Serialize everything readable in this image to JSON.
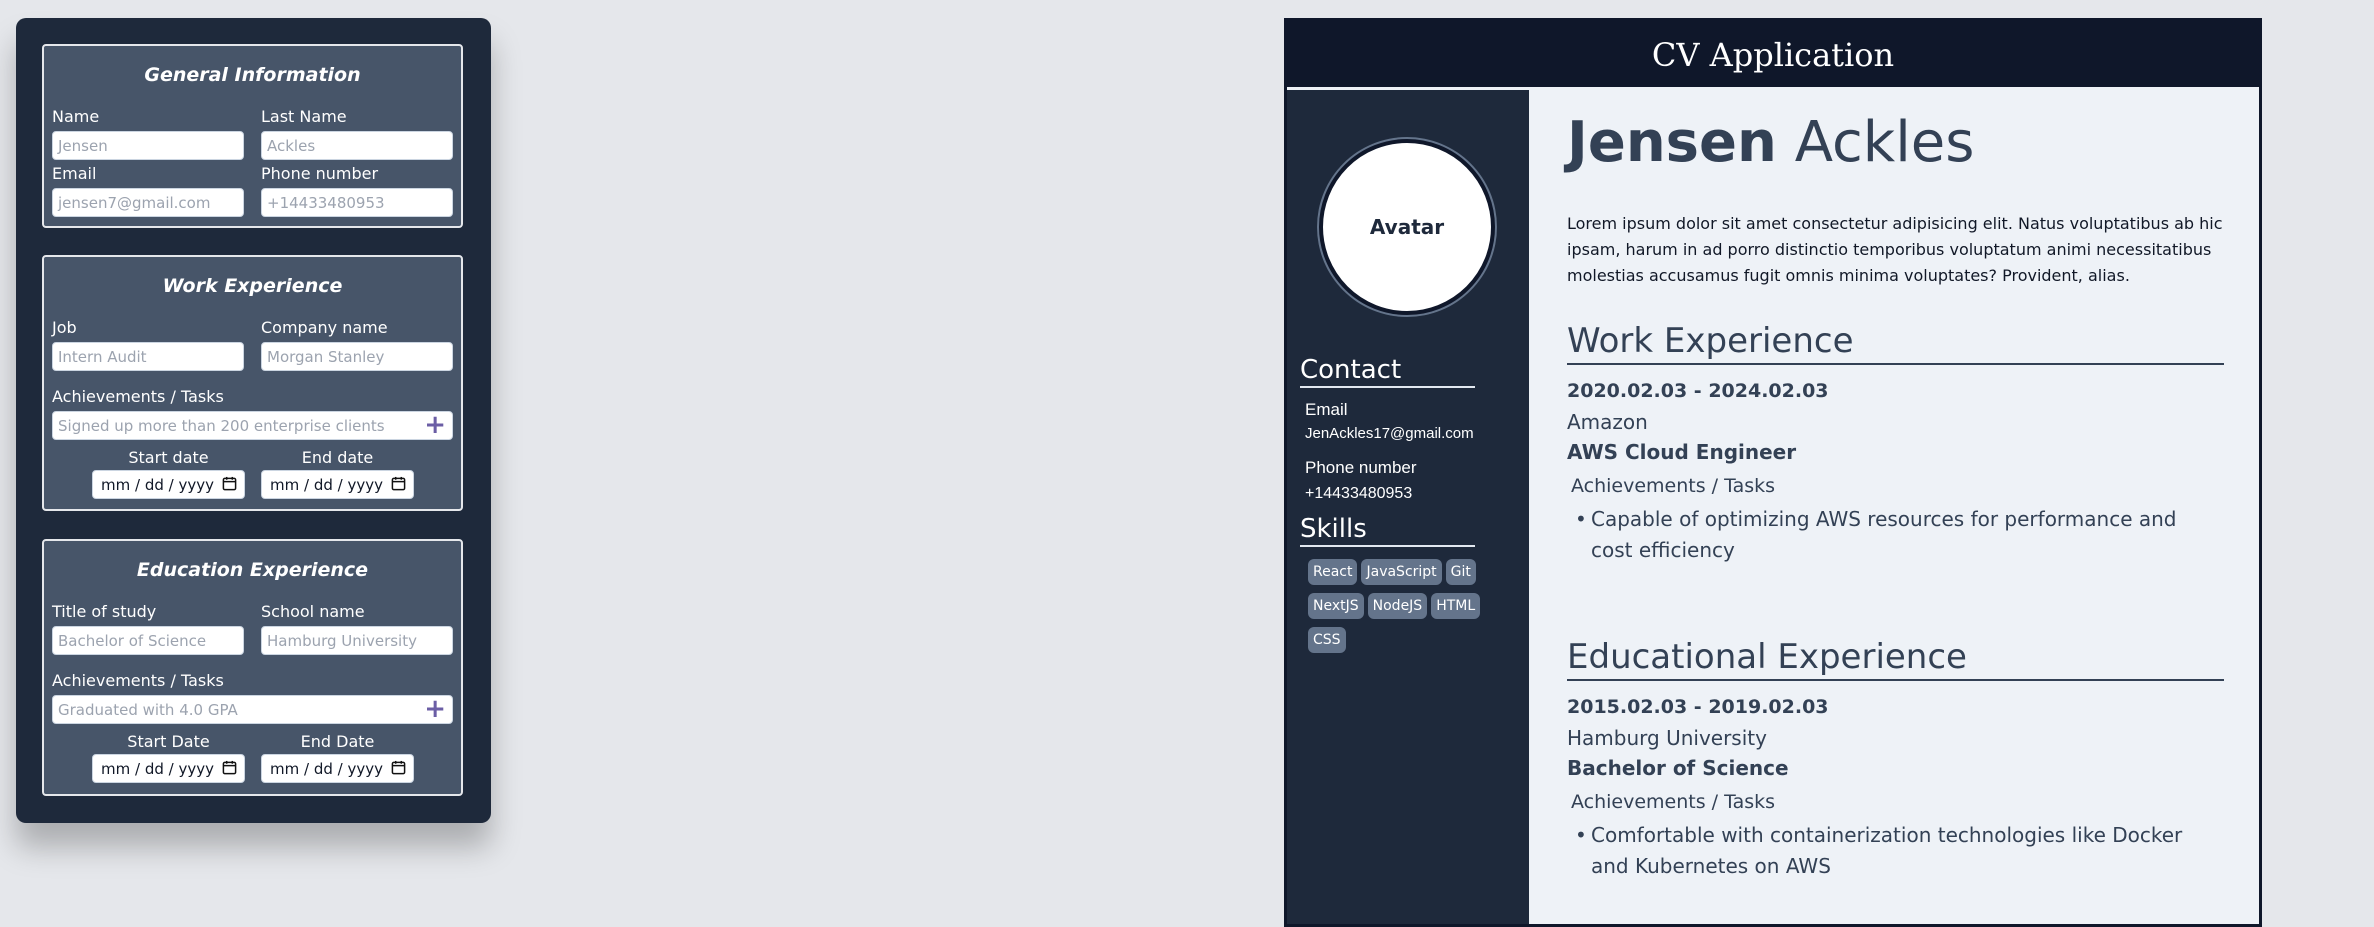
{
  "form": {
    "general": {
      "title": "General Information",
      "name_label": "Name",
      "name_placeholder": "Jensen",
      "last_name_label": "Last Name",
      "last_name_placeholder": "Ackles",
      "email_label": "Email",
      "email_placeholder": "jensen7@gmail.com",
      "phone_label": "Phone number",
      "phone_placeholder": "+14433480953"
    },
    "work": {
      "title": "Work Experience",
      "job_label": "Job",
      "job_placeholder": "Intern Audit",
      "company_label": "Company name",
      "company_placeholder": "Morgan Stanley",
      "achievements_label": "Achievements / Tasks",
      "achievements_placeholder": "Signed up more than 200 enterprise clients",
      "start_label": "Start date",
      "end_label": "End date",
      "start_value": "mm / dd / yyyy",
      "end_value": "mm / dd / yyyy"
    },
    "education": {
      "title": "Education Experience",
      "study_label": "Title of study",
      "study_placeholder": "Bachelor of Science",
      "school_label": "School name",
      "school_placeholder": "Hamburg University",
      "achievements_label": "Achievements / Tasks",
      "achievements_placeholder": "Graduated with 4.0 GPA",
      "start_label": "Start Date",
      "end_label": "End Date",
      "start_value": "mm / dd / yyyy",
      "end_value": "mm / dd / yyyy"
    },
    "add_icon": "plus-icon",
    "calendar_icon": "calendar-icon"
  },
  "cv": {
    "header_title": "CV Application",
    "avatar_label": "Avatar",
    "contact_heading": "Contact",
    "email_label": "Email",
    "email_value": "JenAckles17@gmail.com",
    "phone_label": "Phone number",
    "phone_value": "+14433480953",
    "skills_heading": "Skills",
    "skills": [
      "React",
      "JavaScript",
      "Git",
      "NextJS",
      "NodeJS",
      "HTML",
      "CSS"
    ],
    "first_name": "Jensen",
    "last_name": "Ackles",
    "about": "Lorem ipsum dolor sit amet consectetur adipisicing elit. Natus voluptatibus ab hic ipsam, harum in ad porro distinctio temporibus voluptatum animi necessitatibus molestias accusamus fugit omnis minima voluptates? Provident, alias.",
    "work": {
      "heading": "Work Experience",
      "dates": "2020.02.03 - 2024.02.03",
      "company": "Amazon",
      "role": "AWS Cloud Engineer",
      "achievements_label": "Achievements / Tasks",
      "achievements": [
        "Capable of optimizing AWS resources for performance and cost efficiency"
      ]
    },
    "education": {
      "heading": "Educational Experience",
      "dates": "2015.02.03 - 2019.02.03",
      "school": "Hamburg University",
      "degree": "Bachelor of Science",
      "achievements_label": "Achievements / Tasks",
      "achievements": [
        "Comfortable with containerization technologies like Docker and Kubernetes on AWS"
      ]
    }
  },
  "colors": {
    "page_bg": "#e5e7eb",
    "panel_bg": "#1e293b",
    "section_bg": "#475569",
    "header_bg": "#0f172a",
    "accent_plus": "#6b5ea5",
    "skill_bg": "#64748b"
  }
}
